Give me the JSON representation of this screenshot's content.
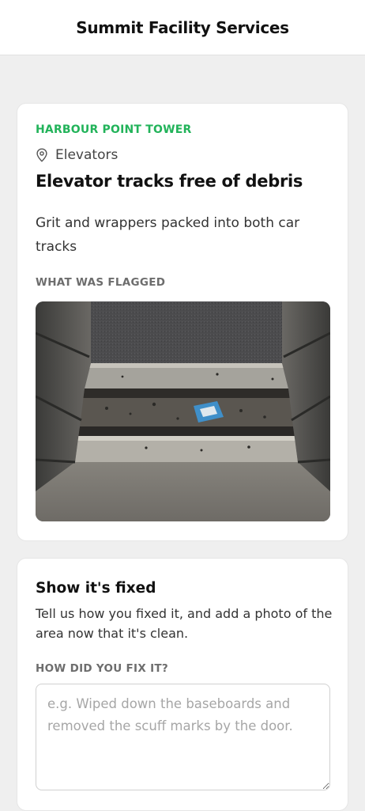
{
  "header": {
    "title": "Summit Facility Services"
  },
  "issue": {
    "site": "HARBOUR POINT TOWER",
    "location": "Elevators",
    "location_icon": "location-pin-icon",
    "title": "Elevator tracks free of debris",
    "description": "Grit and wrappers packed into both car tracks",
    "flagged_label": "WHAT WAS FLAGGED"
  },
  "fix": {
    "title": "Show it's fixed",
    "description": "Tell us how you fixed it, and add a photo of the area now that it's clean.",
    "how_label": "HOW DID YOU FIX IT?",
    "placeholder": "e.g. Wiped down the baseboards and removed the scuff marks by the door.",
    "value": ""
  },
  "colors": {
    "accent": "#22b35a",
    "background": "#efefef",
    "card": "#ffffff"
  }
}
